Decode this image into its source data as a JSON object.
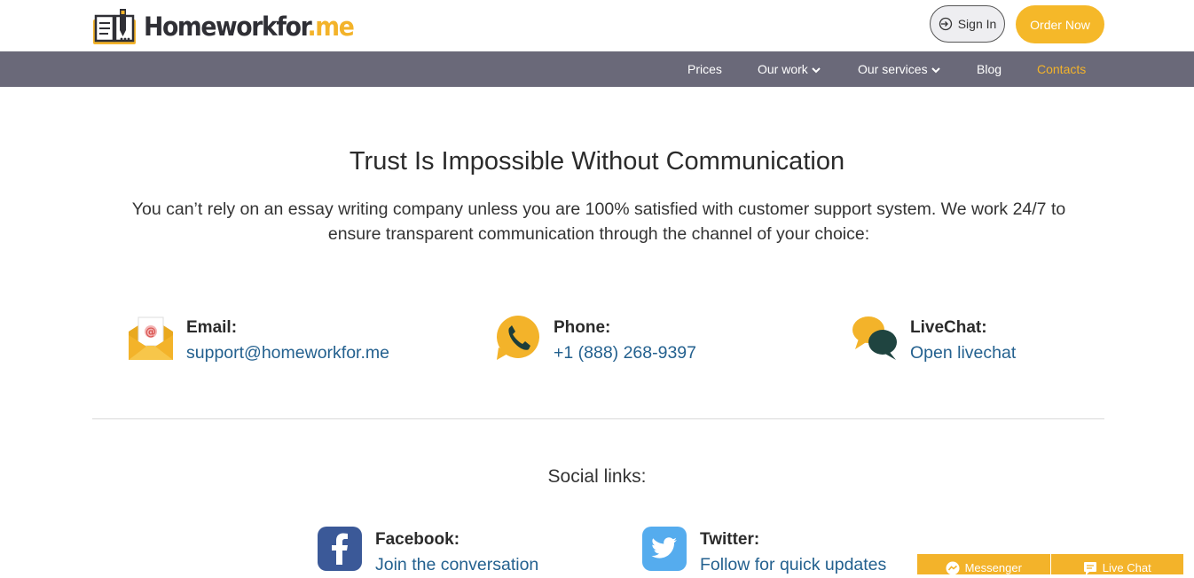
{
  "header": {
    "logo": {
      "name": "Homeworkfor",
      "tld": ".me"
    },
    "signin_label": "Sign In",
    "order_label": "Order Now"
  },
  "nav": {
    "items": [
      {
        "label": "Prices"
      },
      {
        "label": "Our work"
      },
      {
        "label": "Our services"
      },
      {
        "label": "Blog"
      },
      {
        "label": "Contacts"
      }
    ],
    "active": "Contacts"
  },
  "main": {
    "title": "Trust Is Impossible Without Communication",
    "lead": "You can’t rely on an essay writing company unless you are 100% satisfied with customer support system. We work 24/7 to ensure transparent communication through the channel of your choice:",
    "contacts": [
      {
        "icon": "envelope-icon",
        "label": "Email:",
        "value": "support@homeworkfor.me"
      },
      {
        "icon": "phone-bubble-icon",
        "label": "Phone:",
        "value": "+1 (888) 268-9397"
      },
      {
        "icon": "chat-bubbles-icon",
        "label": "LiveChat:",
        "value": "Open livechat"
      }
    ],
    "social_title": "Social links:",
    "social": [
      {
        "icon": "facebook-icon",
        "label": "Facebook:",
        "value": "Join the conversation"
      },
      {
        "icon": "twitter-icon",
        "label": "Twitter:",
        "value": "Follow for quick updates"
      }
    ]
  },
  "chat_widgets": {
    "messenger_label": "Messenger",
    "livechat_label": "Live Chat"
  },
  "colors": {
    "accent": "#f3b32a",
    "nav_bg": "#6a6979",
    "link": "#24618f",
    "facebook": "#3b5998",
    "twitter": "#55acee"
  }
}
